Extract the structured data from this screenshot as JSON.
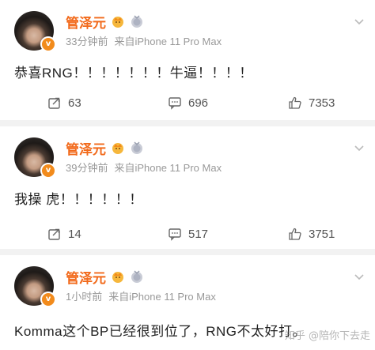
{
  "posts": [
    {
      "user": "管泽元",
      "time": "33分钟前",
      "source": "来自iPhone 11 Pro Max",
      "text": "恭喜RNG！！！！！！！牛逼！！！！",
      "reposts": "63",
      "comments": "696",
      "likes": "7353"
    },
    {
      "user": "管泽元",
      "time": "39分钟前",
      "source": "来自iPhone 11 Pro Max",
      "text": "我操 虎！！！！！！",
      "reposts": "14",
      "comments": "517",
      "likes": "3751"
    },
    {
      "user": "管泽元",
      "time": "1小时前",
      "source": "来自iPhone 11 Pro Max",
      "text": "Komma这个BP已经很到位了，RNG不太好打。"
    }
  ],
  "verify_badge_glyph": "v",
  "watermark": "知乎 @陪你下去走",
  "colors": {
    "name": "#f26a1b",
    "meta": "#999999",
    "separator": "#f2f2f2",
    "action": "#555555",
    "verify": "#f28b1c"
  },
  "icons": [
    "more-chevron-icon",
    "repost-icon",
    "comment-icon",
    "like-icon",
    "crown-badge-icon",
    "medal-badge-icon",
    "verified-badge-icon"
  ]
}
